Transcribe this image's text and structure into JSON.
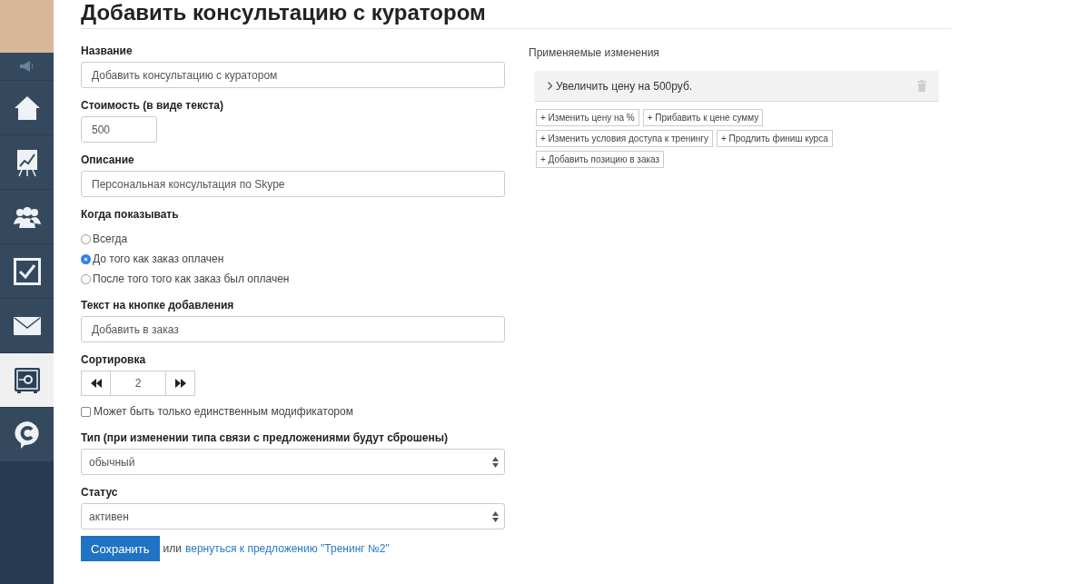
{
  "sidebar": {
    "items": [
      {
        "kind": "home",
        "selected": false
      },
      {
        "kind": "chart",
        "selected": false
      },
      {
        "kind": "people",
        "selected": false
      },
      {
        "kind": "check",
        "selected": false
      },
      {
        "kind": "mail",
        "selected": false
      },
      {
        "kind": "safe",
        "selected": true
      },
      {
        "kind": "chat",
        "selected": false
      }
    ]
  },
  "title": "Добавить консультацию с куратором",
  "form": {
    "fields": [
      {
        "kind": "text",
        "label": "Название",
        "value": "Добавить консультацию с куратором",
        "wide": true
      },
      {
        "kind": "text",
        "label": "Стоимость (в виде текста)",
        "value": "500",
        "wide": false
      },
      {
        "kind": "text",
        "label": "Описание",
        "value": "Персональная консультация по Skype",
        "wide": true
      },
      {
        "kind": "radio",
        "label": "Когда показывать",
        "options": [
          {
            "label": "Всегда",
            "selected": false
          },
          {
            "label": "До того как заказ оплачен",
            "selected": true
          },
          {
            "label": "После того того как заказ был оплачен",
            "selected": false
          }
        ]
      },
      {
        "kind": "text",
        "label": "Текст на кнопке добавления",
        "value": "Добавить в заказ",
        "wide": true
      },
      {
        "kind": "stepper",
        "label": "Сортировка",
        "value": "2"
      },
      {
        "kind": "checkbox",
        "label": "Может быть только единственным модификатором",
        "checked": false
      },
      {
        "kind": "select",
        "label": "Тип (при изменении типа связи с предложениями будут сброшены)",
        "value": "обычный"
      },
      {
        "kind": "select",
        "label": "Статус",
        "value": "активен"
      }
    ],
    "save_button": "Сохранить",
    "or_text": "или",
    "back_link": "вернуться к предложению \"Тренинг №2\""
  },
  "changes": {
    "title": "Применяемые изменения",
    "items": [
      {
        "label": "Увеличить цену на 500руб."
      }
    ],
    "add_buttons": [
      "+ Изменить цену на %",
      "+ Прибавить к цене сумму",
      "+ Изменить условия доступа к тренингу",
      "+ Продлить финиш курса",
      "+ Добавить позицию в заказ"
    ]
  }
}
